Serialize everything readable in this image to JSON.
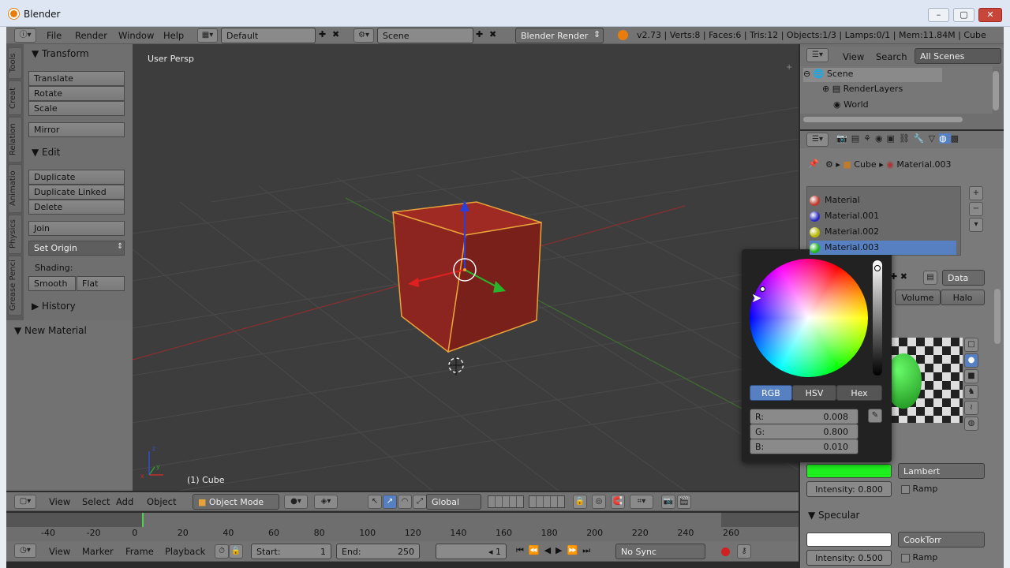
{
  "window": {
    "title": "Blender",
    "min": "–",
    "max": "▢",
    "close": "✕"
  },
  "info": {
    "menus": [
      "File",
      "Render",
      "Window",
      "Help"
    ],
    "layout": "Default",
    "scene": "Scene",
    "engine": "Blender Render",
    "stats": "v2.73 | Verts:8 | Faces:6 | Tris:12 | Objects:1/3 | Lamps:0/1 | Mem:11.84M | Cube"
  },
  "tool_tabs": [
    "Tools",
    "Creat",
    "Relation",
    "Animatio",
    "Physics",
    "Grease Penci"
  ],
  "tools": {
    "transform_title": "Transform",
    "translate": "Translate",
    "rotate": "Rotate",
    "scale": "Scale",
    "mirror": "Mirror",
    "edit_title": "Edit",
    "duplicate": "Duplicate",
    "duplicate_linked": "Duplicate Linked",
    "delete": "Delete",
    "join": "Join",
    "set_origin": "Set Origin",
    "shading_label": "Shading:",
    "smooth": "Smooth",
    "flat": "Flat",
    "history_title": "History",
    "new_material": "New Material"
  },
  "viewport": {
    "view_name": "User Persp",
    "object_label": "(1) Cube",
    "axis_x": "x",
    "axis_y": "y",
    "axis_z": "z"
  },
  "view_header": {
    "menus": [
      "View",
      "Select",
      "Add",
      "Object"
    ],
    "mode": "Object Mode",
    "orientation": "Global"
  },
  "timeline": {
    "ticks": [
      "-40",
      "-20",
      "0",
      "20",
      "40",
      "60",
      "80",
      "100",
      "120",
      "140",
      "160",
      "180",
      "200",
      "220",
      "240",
      "260"
    ],
    "menus": [
      "View",
      "Marker",
      "Frame",
      "Playback"
    ],
    "start_label": "Start:",
    "start_value": "1",
    "end_label": "End:",
    "end_value": "250",
    "current_frame": "1",
    "sync": "No Sync"
  },
  "outliner": {
    "menus": [
      "View",
      "Search"
    ],
    "filter": "All Scenes",
    "items": [
      "Scene",
      "RenderLayers",
      "World"
    ]
  },
  "properties": {
    "breadcrumb_obj": "Cube",
    "breadcrumb_mat": "Material.003",
    "materials": [
      {
        "name": "Material",
        "color": "#c0392b"
      },
      {
        "name": "Material.001",
        "color": "#2a2ac0"
      },
      {
        "name": "Material.002",
        "color": "#b8b800"
      },
      {
        "name": "Material.003",
        "color": "#1eb41e"
      }
    ],
    "data_label": "Data",
    "tabs": [
      "Volume",
      "Halo"
    ],
    "diffuse_shader": "Lambert",
    "intensity": "Intensity: 0.800",
    "ramp": "Ramp",
    "specular_title": "Specular",
    "specular_shader": "CookTorr",
    "spec_intensity": "Intensity: 0.500",
    "spec_ramp": "Ramp",
    "diffuse_color": "#1ef01e"
  },
  "color_picker": {
    "modes": [
      "RGB",
      "HSV",
      "Hex"
    ],
    "r_label": "R:",
    "r": "0.008",
    "g_label": "G:",
    "g": "0.800",
    "b_label": "B:",
    "b": "0.010"
  }
}
